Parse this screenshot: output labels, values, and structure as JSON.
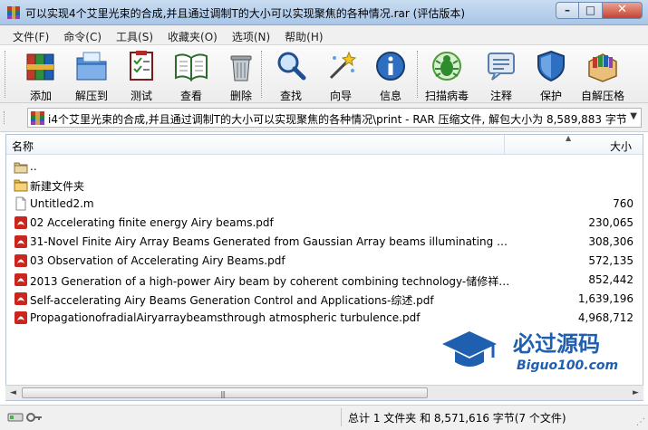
{
  "window": {
    "title": "可以实现4个艾里光束的合成,并且通过调制T的大小可以实现聚焦的各种情况.rar (评估版本)",
    "minimize_glyph": "–",
    "maximize_glyph": "□",
    "close_glyph": "✕"
  },
  "menu": [
    "文件(F)",
    "命令(C)",
    "工具(S)",
    "收藏夹(O)",
    "选项(N)",
    "帮助(H)"
  ],
  "toolbar": [
    {
      "label": "添加",
      "icon": "add-books-icon"
    },
    {
      "label": "解压到",
      "icon": "extract-folder-icon"
    },
    {
      "label": "测试",
      "icon": "test-checklist-icon"
    },
    {
      "label": "查看",
      "icon": "view-book-icon"
    },
    {
      "label": "删除",
      "icon": "trash-icon"
    },
    {
      "label": "查找",
      "icon": "magnifier-icon"
    },
    {
      "label": "向导",
      "icon": "wizard-wand-icon"
    },
    {
      "label": "信息",
      "icon": "info-icon"
    },
    {
      "label": "扫描病毒",
      "icon": "virus-bug-icon"
    },
    {
      "label": "注释",
      "icon": "comment-icon"
    },
    {
      "label": "保护",
      "icon": "shield-icon"
    },
    {
      "label": "自解压格",
      "icon": "sfx-box-icon"
    }
  ],
  "address": {
    "path": "i4个艾里光束的合成,并且通过调制T的大小可以实现聚焦的各种情况\\print - RAR 压缩文件, 解包大小为 8,589,883 字节",
    "dropdown_glyph": "▼"
  },
  "columns": {
    "name": "名称",
    "size": "大小",
    "sort_glyph": "▲"
  },
  "files": [
    {
      "name": "..",
      "size": "",
      "type": "folder-up"
    },
    {
      "name": "新建文件夹",
      "size": "",
      "type": "folder"
    },
    {
      "name": "Untitled2.m",
      "size": "760",
      "type": "file"
    },
    {
      "name": "02 Accelerating finite energy Airy beams.pdf",
      "size": "230,065",
      "type": "pdf"
    },
    {
      "name": "31-Novel Finite Airy Array Beams Generated from Gaussian Array beams illuminating an ...",
      "size": "308,306",
      "type": "pdf"
    },
    {
      "name": "03 Observation of Accelerating Airy Beams.pdf",
      "size": "572,135",
      "type": "pdf"
    },
    {
      "name": "2013 Generation of a high-power Airy beam by coherent combining technology-储修祥....",
      "size": "852,442",
      "type": "pdf"
    },
    {
      "name": "Self-accelerating Airy Beams Generation Control and Applications-综述.pdf",
      "size": "1,639,196",
      "type": "pdf"
    },
    {
      "name": "PropagationofradialAiryarraybeamsthrough atmospheric turbulence.pdf",
      "size": "4,968,712",
      "type": "pdf"
    }
  ],
  "watermark": {
    "cn": "必过源码",
    "url": "Biguo100.com"
  },
  "scrollbar": {
    "left_glyph": "◄",
    "right_glyph": "►",
    "grip_glyph": "|||"
  },
  "status": {
    "text": "总计 1 文件夹 和 8,571,616 字节(7 个文件)",
    "resize_glyph": "⋰"
  },
  "colors": {
    "title_bg": "#b9d1ee",
    "accent_blue": "#1f5fb0",
    "pdf_red": "#c8261e"
  }
}
